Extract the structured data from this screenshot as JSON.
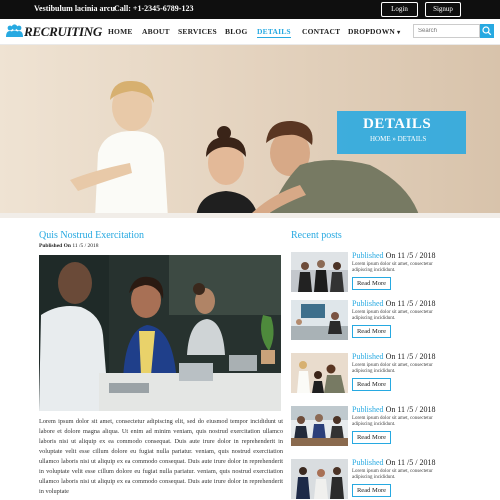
{
  "topbar": {
    "tagline": "Vestibulum lacinia arcu",
    "phone": "Call: +1-2345-6789-123",
    "login_label": "Login",
    "signup_label": "Signup"
  },
  "brand": {
    "name": "RECRUITING"
  },
  "nav": {
    "items": [
      "HOME",
      "ABOUT",
      "SERVICES",
      "BLOG",
      "DETAILS",
      "CONTACT",
      "DROPDOWN"
    ],
    "active": "DETAILS",
    "dropdown_caret": "▾"
  },
  "search": {
    "placeholder": "Search"
  },
  "hero": {
    "title": "DETAILS",
    "breadcrumb": [
      "HOME",
      "»",
      "DETAILS"
    ]
  },
  "post": {
    "title": "Quis Nostrud Exercitation",
    "meta_label": "Published On",
    "meta_date": "11 /5 / 2018",
    "body": "Lorem ipsum dolor sit amet, consectetur adipiscing elit, sed do eiusmod tempor incididunt ut labore et dolore magna aliqua. Ut enim ad minim veniam, quis nostrud exercitation ullamco laboris nisi ut aliquip ex ea commodo consequat. Duis aute irure dolor in reprehenderit in voluptate velit esse cillum dolore eu fugiat nulla pariatur. veniam, quis nostrud exercitation ullamco laboris nisi ut aliquip ex ea commodo consequat. Duis aute irure dolor in reprehenderit in voluptate velit esse cillum dolore eu fugiat nulla pariatur. veniam, quis nostrud exercitation ullamco laboris nisi ut aliquip ex ea commodo consequat. Duis aute irure dolor in reprehenderit in voluptate"
  },
  "sidebar": {
    "title": "Recent posts",
    "posts": [
      {
        "pub": "Published",
        "on": "On 11 /5 / 2018",
        "excerpt": "Lorem ipsum dolor sit amet, consectetur adipiscing incididunt.",
        "button": "Read More"
      },
      {
        "pub": "Published",
        "on": "On 11 /5 / 2018",
        "excerpt": "Lorem ipsum dolor sit amet, consectetur adipiscing incididunt.",
        "button": "Read More"
      },
      {
        "pub": "Published",
        "on": "On 11 /5 / 2018",
        "excerpt": "Lorem ipsum dolor sit amet, consectetur adipiscing incididunt.",
        "button": "Read More"
      },
      {
        "pub": "Published",
        "on": "On 11 /5 / 2018",
        "excerpt": "Lorem ipsum dolor sit amet, consectetur adipiscing incididunt.",
        "button": "Read More"
      },
      {
        "pub": "Published",
        "on": "On 11 /5 / 2018",
        "excerpt": "Lorem ipsum dolor sit amet, consectetur adipiscing incididunt.",
        "button": "Read More"
      }
    ]
  },
  "colors": {
    "accent": "#27a9e1",
    "topbar": "#0f0f0f"
  },
  "icons": {
    "logo": "people-group-icon",
    "search": "search-icon"
  }
}
